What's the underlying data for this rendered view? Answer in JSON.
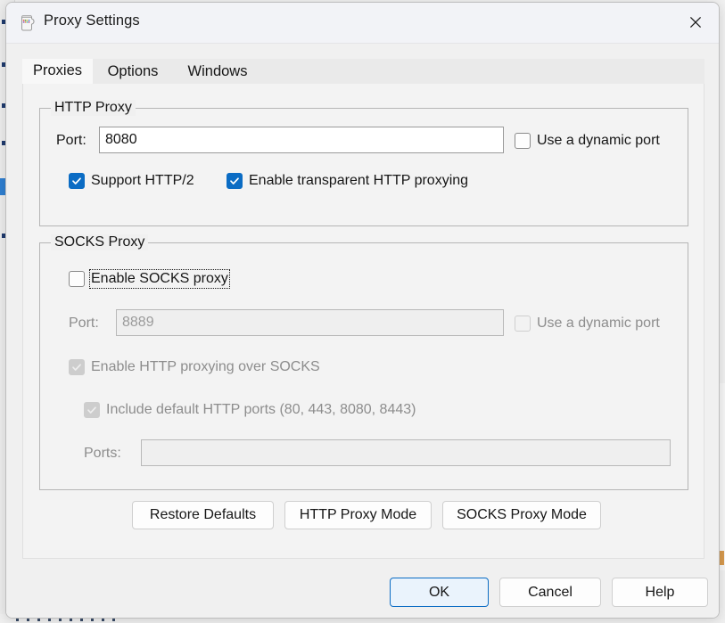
{
  "window": {
    "title": "Proxy Settings",
    "icon": "jug-icon",
    "close_label": "×"
  },
  "tabs": [
    {
      "id": "proxies",
      "label": "Proxies",
      "active": true
    },
    {
      "id": "options",
      "label": "Options",
      "active": false
    },
    {
      "id": "windows",
      "label": "Windows",
      "active": false
    }
  ],
  "http_group": {
    "title": "HTTP Proxy",
    "port_label": "Port:",
    "port_value": "8080",
    "port_placeholder": "",
    "dynamic_port": {
      "label": "Use a dynamic port",
      "checked": false,
      "disabled": false
    },
    "support_http2": {
      "label": "Support HTTP/2",
      "checked": true,
      "disabled": false
    },
    "transparent": {
      "label": "Enable transparent HTTP proxying",
      "checked": true,
      "disabled": false
    }
  },
  "socks_group": {
    "title": "SOCKS Proxy",
    "enable": {
      "label": "Enable SOCKS proxy",
      "checked": false,
      "disabled": false,
      "focused": true
    },
    "port_label": "Port:",
    "port_value": "8889",
    "port_disabled": true,
    "dynamic_port": {
      "label": "Use a dynamic port",
      "checked": false,
      "disabled": true
    },
    "http_over_socks": {
      "label": "Enable HTTP proxying over SOCKS",
      "checked": true,
      "disabled": true
    },
    "include_default_ports": {
      "label": "Include default HTTP ports (80, 443, 8080, 8443)",
      "checked": true,
      "disabled": true
    },
    "ports_label": "Ports:",
    "ports_value": "",
    "ports_disabled": true
  },
  "action_buttons": {
    "restore_defaults": "Restore Defaults",
    "http_proxy_mode": "HTTP Proxy Mode",
    "socks_proxy_mode": "SOCKS Proxy Mode"
  },
  "footer_buttons": {
    "ok": "OK",
    "cancel": "Cancel",
    "help": "Help"
  },
  "colors": {
    "accent": "#0b6cc4",
    "dialog_bg": "#f0f0f0",
    "panel_bg": "#f3f3f3",
    "titlebar_bg": "#f2f3f7",
    "disabled_text": "#8d8d8d",
    "group_border": "#b5b5b5"
  }
}
